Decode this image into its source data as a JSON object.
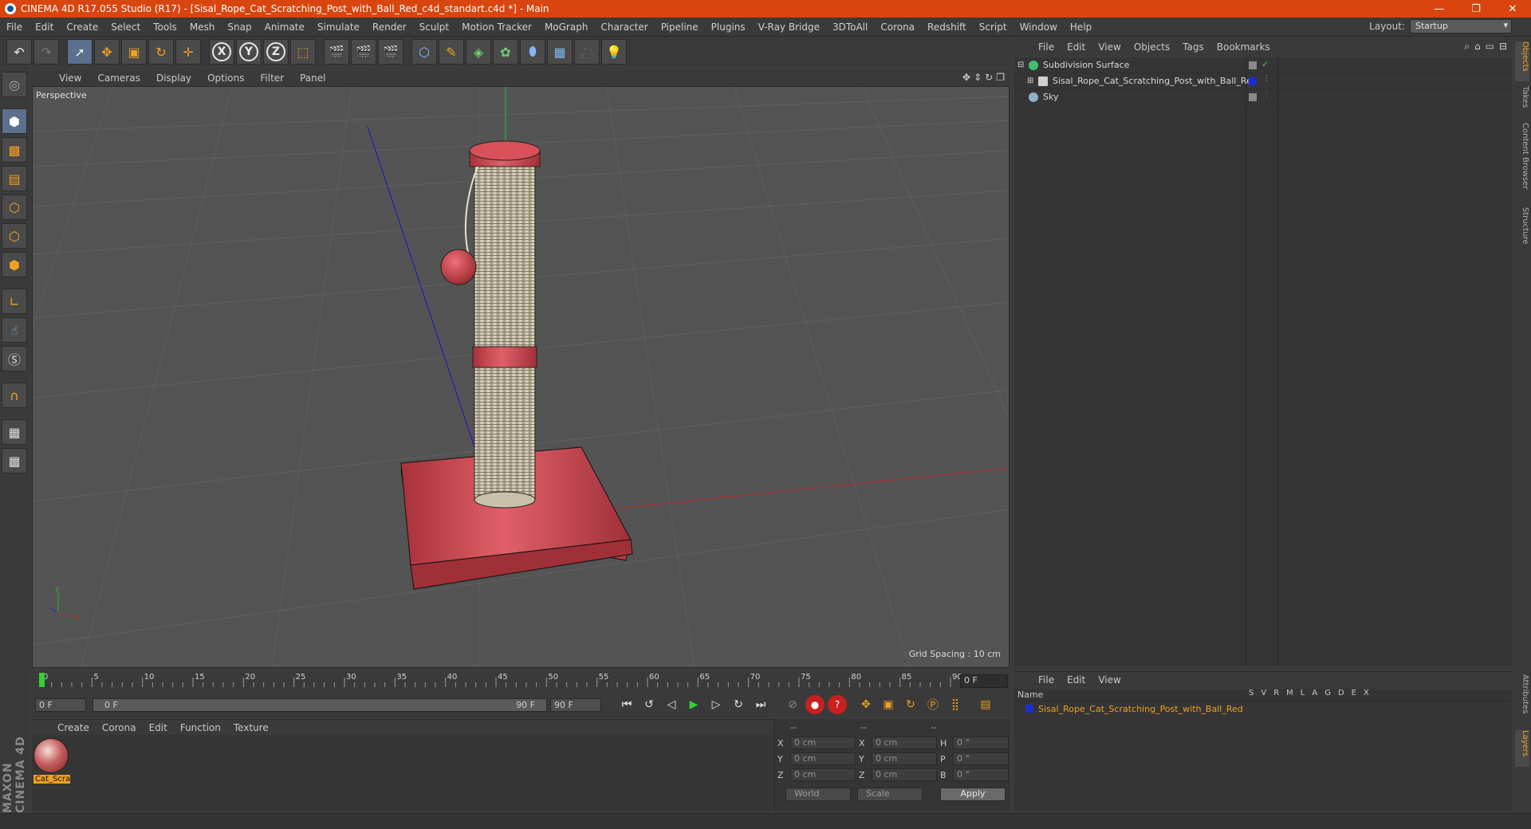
{
  "window": {
    "title": "CINEMA 4D R17.055 Studio (R17) - [Sisal_Rope_Cat_Scratching_Post_with_Ball_Red_c4d_standart.c4d *] - Main",
    "controls": [
      "—",
      "❐",
      "✕"
    ]
  },
  "menubar": {
    "items": [
      "File",
      "Edit",
      "Create",
      "Select",
      "Tools",
      "Mesh",
      "Snap",
      "Animate",
      "Simulate",
      "Render",
      "Sculpt",
      "Motion Tracker",
      "MoGraph",
      "Character",
      "Pipeline",
      "Plugins",
      "V-Ray Bridge",
      "3DToAll",
      "Corona",
      "Redshift",
      "Script",
      "Window",
      "Help"
    ],
    "layout_label": "Layout:",
    "layout_value": "Startup"
  },
  "toolbar": {
    "axis_labels": [
      "X",
      "Y",
      "Z"
    ]
  },
  "viewport": {
    "menu": [
      "View",
      "Cameras",
      "Display",
      "Options",
      "Filter",
      "Panel"
    ],
    "camera": "Perspective",
    "grid_spacing": "Grid Spacing : 10 cm",
    "axis_labels": {
      "x": "x",
      "y": "y"
    }
  },
  "timeline": {
    "ticks": [
      "0",
      "5",
      "10",
      "15",
      "20",
      "25",
      "30",
      "35",
      "40",
      "45",
      "50",
      "55",
      "60",
      "65",
      "70",
      "75",
      "80",
      "85",
      "90"
    ],
    "current_frame": "0 F",
    "start_field": "0 F",
    "range_start": "0 F",
    "range_end": "90 F",
    "end_field": "90 F"
  },
  "materials": {
    "menu": [
      "Create",
      "Corona",
      "Edit",
      "Function",
      "Texture"
    ],
    "items": [
      {
        "label": "Cat_Scra"
      }
    ]
  },
  "coordinates": {
    "headers": [
      "--",
      "--",
      "--"
    ],
    "rows": [
      {
        "l1": "X",
        "v1": "0 cm",
        "l2": "X",
        "v2": "0 cm",
        "l3": "H",
        "v3": "0 °"
      },
      {
        "l1": "Y",
        "v1": "0 cm",
        "l2": "Y",
        "v2": "0 cm",
        "l3": "P",
        "v3": "0 °"
      },
      {
        "l1": "Z",
        "v1": "0 cm",
        "l2": "Z",
        "v2": "0 cm",
        "l3": "B",
        "v3": "0 °"
      }
    ],
    "space": "World",
    "mode": "Scale",
    "apply": "Apply"
  },
  "object_manager": {
    "menu": [
      "File",
      "Edit",
      "View",
      "Objects",
      "Tags",
      "Bookmarks"
    ],
    "objects": [
      {
        "name": "Subdivision Surface",
        "icon_color": "#3fbf6f"
      },
      {
        "name": "Sisal_Rope_Cat_Scratching_Post_with_Ball_Red",
        "icon_color": "#d0d0d0",
        "tag_color": "#1a2fd0"
      },
      {
        "name": "Sky",
        "icon_color": "#8fb0d0"
      }
    ]
  },
  "layers": {
    "menu": [
      "File",
      "Edit",
      "View"
    ],
    "name_header": "Name",
    "columns": [
      "S",
      "V",
      "R",
      "M",
      "L",
      "A",
      "G",
      "D",
      "E",
      "X"
    ],
    "items": [
      {
        "name": "Sisal_Rope_Cat_Scratching_Post_with_Ball_Red",
        "color": "#1a2fd0"
      }
    ]
  },
  "side_tabs": [
    "Objects",
    "Takes",
    "Content Browser",
    "Structure",
    "Attributes",
    "Layers"
  ],
  "branding": "MAXON CINEMA 4D",
  "colors": {
    "accent": "#f0a020",
    "titlebar": "#d8450e",
    "post_red": "#d04a50",
    "rope": "#d8cfb8"
  }
}
